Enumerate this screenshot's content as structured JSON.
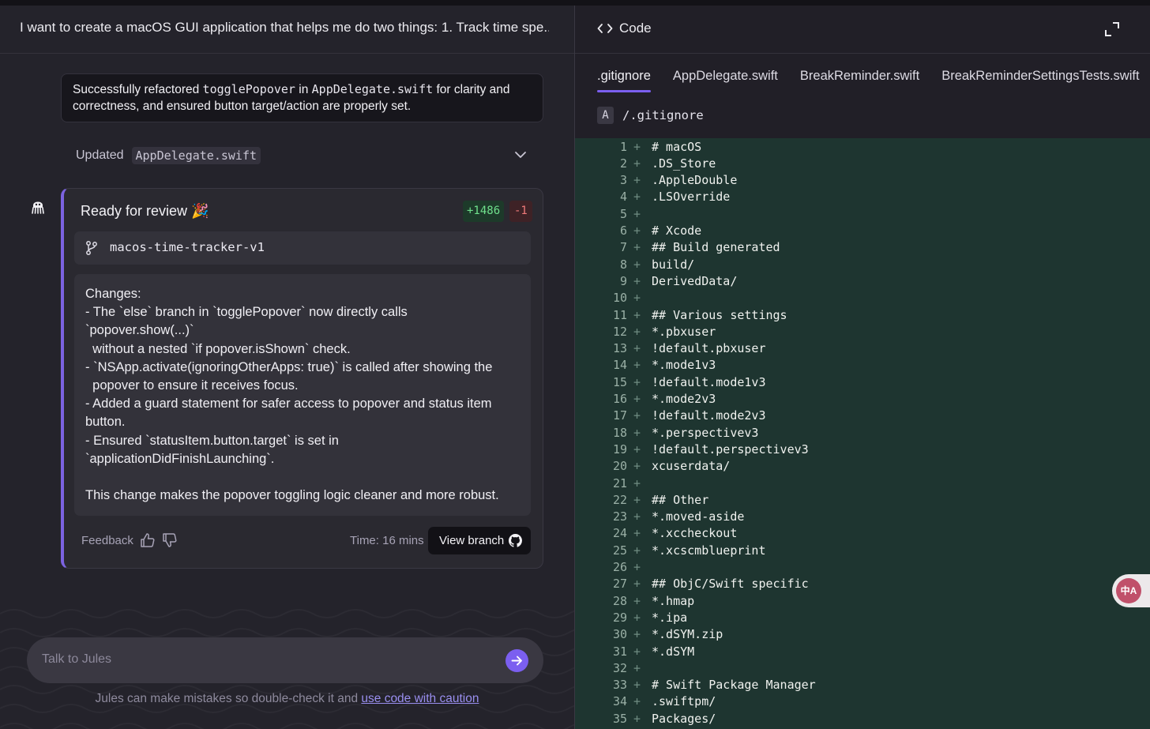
{
  "conversation": {
    "title": "I want to create a macOS GUI application that helps me do two things: 1. Track time spe..."
  },
  "summary": {
    "text_before": "Successfully refactored ",
    "code1": "togglePopover",
    "text_mid": " in ",
    "code2": "AppDelegate.swift",
    "text_after": " for clarity and correctness, and ensured button target/action are properly set."
  },
  "updated": {
    "label": "Updated",
    "file": "AppDelegate.swift"
  },
  "review": {
    "title": "Ready for review 🎉",
    "additions": "+1486",
    "deletions": "-1",
    "branch": "macos-time-tracker-v1",
    "changes": "Changes:\n- The `else` branch in `togglePopover` now directly calls\n`popover.show(...)`\n  without a nested `if popover.isShown` check.\n- `NSApp.activate(ignoringOtherApps: true)` is called after showing the\n  popover to ensure it receives focus.\n- Added a guard statement for safer access to popover and status item\nbutton.\n- Ensured `statusItem.button.target` is set in\n`applicationDidFinishLaunching`.\n\nThis change makes the popover toggling logic cleaner and more robust.",
    "feedback_label": "Feedback",
    "time_label": "Time: 16 mins",
    "view_branch_label": "View branch"
  },
  "chat": {
    "placeholder": "Talk to Jules",
    "disclaimer_text": "Jules can make mistakes so double-check it and ",
    "disclaimer_link": "use code with caution"
  },
  "code_panel": {
    "title": "Code",
    "tabs": [
      ".gitignore",
      "AppDelegate.swift",
      "BreakReminder.swift",
      "BreakReminderSettingsTests.swift"
    ],
    "active_tab": ".gitignore",
    "file_status": "A",
    "file_path": "/.gitignore",
    "lines": [
      "# macOS",
      ".DS_Store",
      ".AppleDouble",
      ".LSOverride",
      "",
      "# Xcode",
      "## Build generated",
      "build/",
      "DerivedData/",
      "",
      "## Various settings",
      "*.pbxuser",
      "!default.pbxuser",
      "*.mode1v3",
      "!default.mode1v3",
      "*.mode2v3",
      "!default.mode2v3",
      "*.perspectivev3",
      "!default.perspectivev3",
      "xcuserdata/",
      "",
      "## Other",
      "*.moved-aside",
      "*.xccheckout",
      "*.xcscmblueprint",
      "",
      "## ObjC/Swift specific",
      "*.hmap",
      "*.ipa",
      "*.dSYM.zip",
      "*.dSYM",
      "",
      "# Swift Package Manager",
      ".swiftpm/",
      "Packages/"
    ]
  },
  "colors": {
    "accent": "#7b5ff0",
    "addition": "#6fe08c",
    "deletion": "#f07a7a",
    "diff_background": "#1e3530"
  },
  "icons": {
    "avatar": "octopus-icon",
    "code": "code-brackets-icon",
    "expand": "expand-icon",
    "branch": "git-branch-icon",
    "github": "github-icon",
    "send": "arrow-right-icon",
    "translate": "translate-icon"
  }
}
